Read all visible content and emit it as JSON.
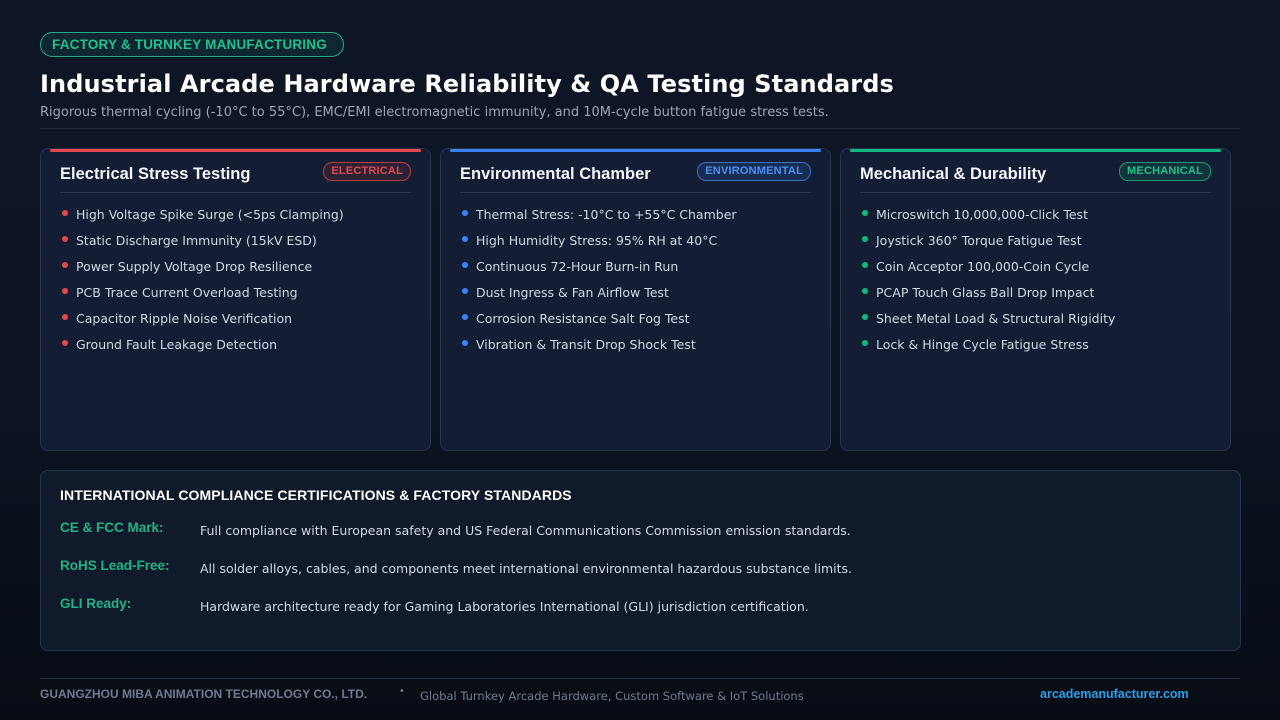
{
  "header": {
    "badge": "FACTORY & TURNKEY MANUFACTURING",
    "title": "Industrial Arcade Hardware Reliability & QA Testing Standards",
    "subtitle": "Rigorous thermal cycling (-10°C to 55°C), EMC/EMI electromagnetic immunity, and 10M-cycle button fatigue stress tests."
  },
  "colors": {
    "electrical": "#e5484d",
    "environmental": "#3b82f6",
    "mechanical": "#10b981"
  },
  "cards": [
    {
      "title": "Electrical Stress Testing",
      "tag": "ELECTRICAL",
      "items": [
        "High Voltage Spike Surge (<5ps Clamping)",
        "Static Discharge Immunity (15kV ESD)",
        "Power Supply Voltage Drop Resilience",
        "PCB Trace Current Overload Testing",
        "Capacitor Ripple Noise Verification",
        "Ground Fault Leakage Detection"
      ]
    },
    {
      "title": "Environmental Chamber",
      "tag": "ENVIRONMENTAL",
      "items": [
        "Thermal Stress: -10°C to +55°C Chamber",
        "High Humidity Stress: 95% RH at 40°C",
        "Continuous 72-Hour Burn-in Run",
        "Dust Ingress & Fan Airflow Test",
        "Corrosion Resistance Salt Fog Test",
        "Vibration & Transit Drop Shock Test"
      ]
    },
    {
      "title": "Mechanical & Durability",
      "tag": "MECHANICAL",
      "items": [
        "Microswitch 10,000,000-Click Test",
        "Joystick 360° Torque Fatigue Test",
        "Coin Acceptor 100,000-Coin Cycle",
        "PCAP Touch Glass Ball Drop Impact",
        "Sheet Metal Load & Structural Rigidity",
        "Lock & Hinge Cycle Fatigue Stress"
      ]
    }
  ],
  "compliance": {
    "title": "INTERNATIONAL COMPLIANCE CERTIFICATIONS & FACTORY STANDARDS",
    "rows": [
      {
        "label": "CE & FCC Mark:",
        "text": "Full compliance with European safety and US Federal Communications Commission emission standards."
      },
      {
        "label": "RoHS Lead-Free:",
        "text": "All solder alloys, cables, and components meet international environmental hazardous substance limits."
      },
      {
        "label": "GLI Ready:",
        "text": "Hardware architecture ready for Gaming Laboratories International (GLI) jurisdiction certification."
      }
    ]
  },
  "footer": {
    "company": "GUANGZHOU MIBA ANIMATION TECHNOLOGY CO., LTD.",
    "separator": "•",
    "tagline": "Global Turnkey Arcade Hardware, Custom Software & IoT Solutions",
    "url": "arcademanufacturer.com"
  }
}
